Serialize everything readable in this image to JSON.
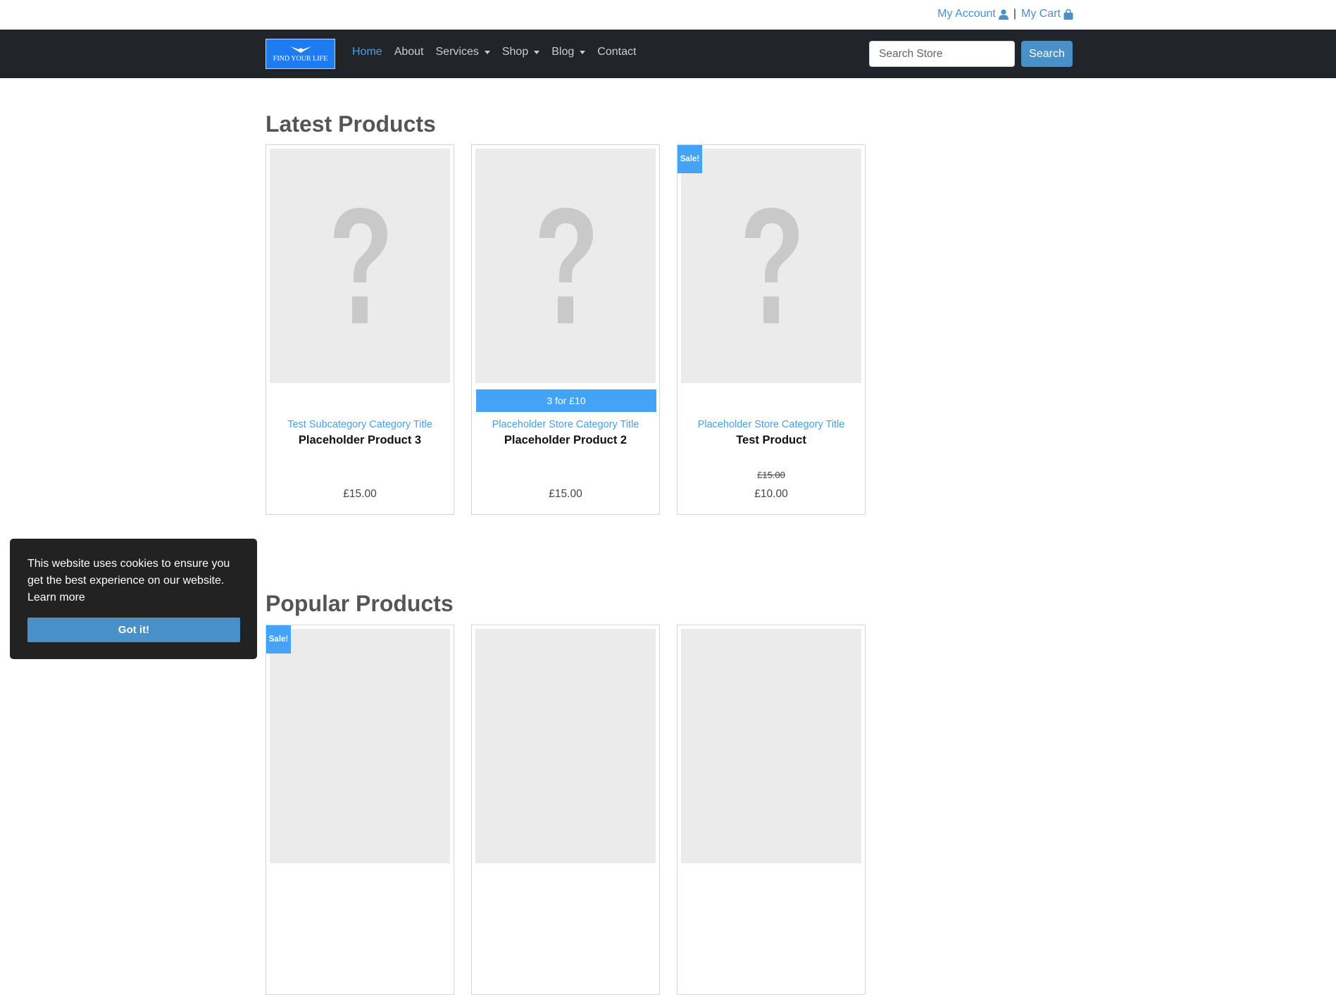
{
  "topbar": {
    "account_label": "My Account",
    "separator": "|",
    "cart_label": "My Cart"
  },
  "navbar": {
    "logo_text": "FIND YOUR LIFE",
    "items": [
      {
        "label": "Home",
        "active": true,
        "dropdown": false
      },
      {
        "label": "About",
        "active": false,
        "dropdown": false
      },
      {
        "label": "Services",
        "active": false,
        "dropdown": true
      },
      {
        "label": "Shop",
        "active": false,
        "dropdown": true
      },
      {
        "label": "Blog",
        "active": false,
        "dropdown": true
      },
      {
        "label": "Contact",
        "active": false,
        "dropdown": false
      }
    ],
    "search_placeholder": "Search Store",
    "search_button": "Search"
  },
  "latest": {
    "title": "Latest Products",
    "products": [
      {
        "category": "Test Subcategory Category Title",
        "name": "Placeholder Product 3",
        "price": "£15.00",
        "old_price": "",
        "sale": false,
        "offer": ""
      },
      {
        "category": "Placeholder Store Category Title",
        "name": "Placeholder Product 2",
        "price": "£15.00",
        "old_price": "",
        "sale": false,
        "offer": "3 for £10"
      },
      {
        "category": "Placeholder Store Category Title",
        "name": "Test Product",
        "price": "£10.00",
        "old_price": "£15.00",
        "sale": true,
        "offer": ""
      }
    ]
  },
  "popular": {
    "title": "Popular Products",
    "products": [
      {
        "sale": true
      },
      {
        "sale": false
      },
      {
        "sale": false
      }
    ]
  },
  "badges": {
    "sale": "Sale!"
  },
  "cookie": {
    "message": "This website uses cookies to ensure you get the best experience on our website.",
    "learn_more": "Learn more",
    "button": "Got it!"
  },
  "colors": {
    "nav_bg": "#212529",
    "accent": "#4a90c8",
    "badge": "#45a3f5",
    "link": "#4a9ee8"
  }
}
